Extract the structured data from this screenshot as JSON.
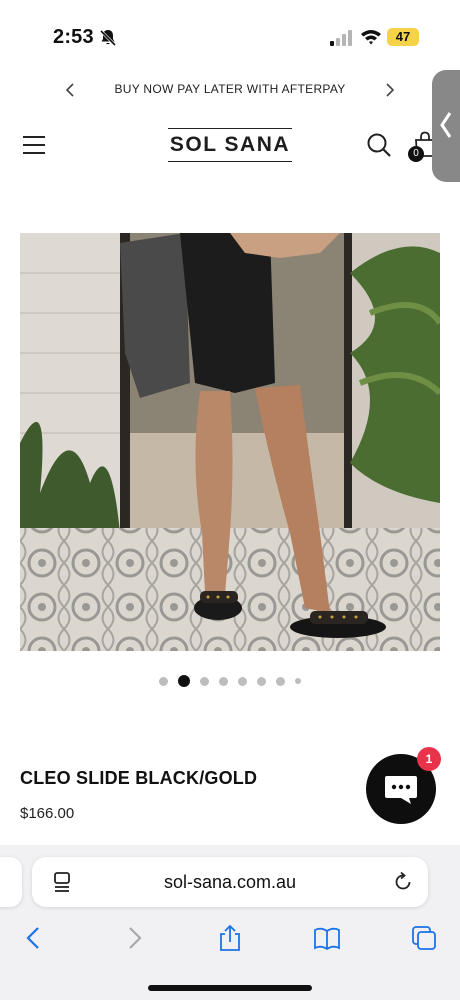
{
  "status_bar": {
    "time": "2:53",
    "battery": "47"
  },
  "announcement": {
    "text": "BUY NOW PAY LATER WITH AFTERPAY"
  },
  "header": {
    "logo": "SOL SANA",
    "cart_count": "0"
  },
  "product": {
    "pagination": {
      "total": 8,
      "active_index": 1
    },
    "title": "CLEO SLIDE BLACK/GOLD",
    "price": "$166.00"
  },
  "chat": {
    "badge": "1"
  },
  "browser": {
    "url": "sol-sana.com.au"
  },
  "colors": {
    "accent_badge": "#e8334a",
    "battery": "#f5d247",
    "chat_bg": "#0e0e0e"
  },
  "icons": [
    "bell-slash-icon",
    "signal-icon",
    "wifi-icon",
    "chevron-left-icon",
    "chevron-right-icon",
    "menu-icon",
    "search-icon",
    "bag-icon",
    "chat-icon",
    "reader-icon",
    "reload-icon",
    "back-icon",
    "forward-icon",
    "share-icon",
    "bookmarks-icon",
    "tabs-icon"
  ]
}
